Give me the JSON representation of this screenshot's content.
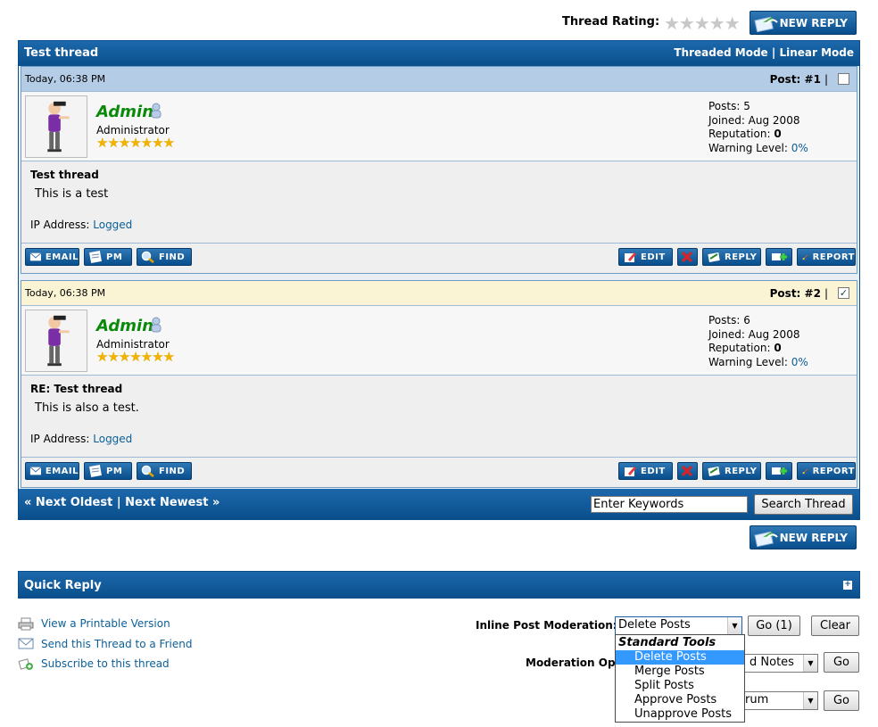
{
  "rating": {
    "label": "Thread Rating:",
    "stars": "★★★★★"
  },
  "buttons": {
    "new_reply": "NEW REPLY"
  },
  "thread": {
    "title": "Test thread",
    "modes": {
      "threaded": "Threaded Mode",
      "separator": "|",
      "linear": "Linear Mode"
    }
  },
  "posts": [
    {
      "date": "Today, 06:38 PM",
      "number": "Post: #1",
      "checked": false,
      "username": "Admin",
      "user_title": "Administrator",
      "user_stars": "★★★★★★★",
      "stats": {
        "posts": "Posts: 5",
        "joined": "Joined: Aug 2008",
        "reputation_label": "Reputation:",
        "reputation": "0",
        "warning_label": "Warning Level:",
        "warning": "0%"
      },
      "subject": "Test thread",
      "message": "This is a test",
      "ip_label": "IP Address:",
      "ip_value": "Logged"
    },
    {
      "date": "Today, 06:38 PM",
      "number": "Post: #2",
      "checked": true,
      "username": "Admin",
      "user_title": "Administrator",
      "user_stars": "★★★★★★★",
      "stats": {
        "posts": "Posts: 6",
        "joined": "Joined: Aug 2008",
        "reputation_label": "Reputation:",
        "reputation": "0",
        "warning_label": "Warning Level:",
        "warning": "0%"
      },
      "subject": "RE: Test thread",
      "message": "This is also a test.",
      "ip_label": "IP Address:",
      "ip_value": "Logged"
    }
  ],
  "post_actions": {
    "email": "EMAIL",
    "pm": "PM",
    "find": "FIND",
    "edit": "EDIT",
    "reply": "REPLY",
    "report": "REPORT"
  },
  "nav": {
    "next_oldest": "« Next Oldest",
    "separator": "|",
    "next_newest": "Next Newest »"
  },
  "search": {
    "value": "Enter Keywords",
    "button": "Search Thread"
  },
  "quick_reply": {
    "title": "Quick Reply",
    "toggle": "+"
  },
  "links": [
    {
      "label": "View a Printable Version",
      "icon": "printer-icon"
    },
    {
      "label": "Send this Thread to a Friend",
      "icon": "envelope-icon"
    },
    {
      "label": "Subscribe to this thread",
      "icon": "subscribe-icon"
    }
  ],
  "moderation": {
    "inline_label": "Inline Post Moderation:",
    "inline_selected": "Delete Posts",
    "go_count": "Go (1)",
    "clear": "Clear",
    "options_label": "Moderation Opt",
    "options_selected_partial": "d Notes",
    "forum_select_partial": "rum",
    "go": "Go",
    "dropdown": {
      "group": "Standard Tools",
      "options": [
        "Delete Posts",
        "Merge Posts",
        "Split Posts",
        "Approve Posts",
        "Unapprove Posts"
      ],
      "selected_index": 0
    }
  },
  "colors": {
    "header_blue": "#0a4f8c",
    "post1_head": "#b4cce6",
    "post2_head": "#fbf4d4",
    "username_green": "#0a8a0a",
    "link_blue": "#0b5f99"
  }
}
